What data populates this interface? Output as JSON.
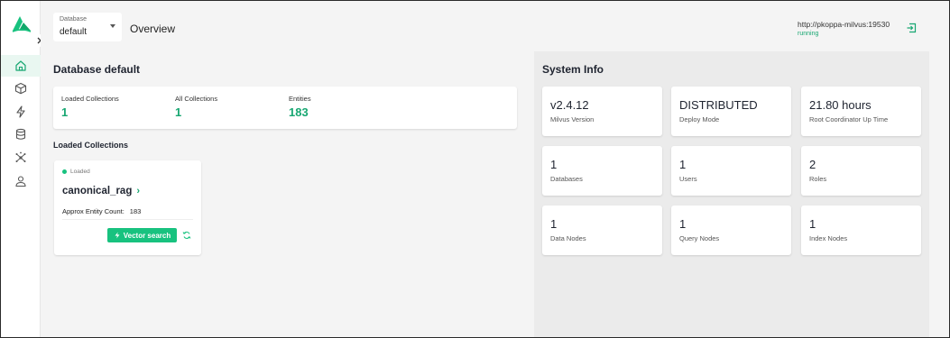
{
  "header": {
    "db_select_label": "Database",
    "db_select_value": "default",
    "page_title": "Overview",
    "connection_url": "http://pkoppa-milvus:19530",
    "connection_status": "running"
  },
  "overview": {
    "title": "Database default",
    "stats": [
      {
        "label": "Loaded Collections",
        "value": "1"
      },
      {
        "label": "All Collections",
        "value": "1"
      },
      {
        "label": "Entities",
        "value": "183"
      }
    ],
    "loaded_heading": "Loaded Collections",
    "collection": {
      "status": "Loaded",
      "name": "canonical_rag",
      "count_label": "Approx Entity Count:",
      "count_value": "183",
      "search_button": "Vector search"
    }
  },
  "system_info": {
    "title": "System Info",
    "cards": [
      {
        "value": "v2.4.12",
        "label": "Milvus Version"
      },
      {
        "value": "DISTRIBUTED",
        "label": "Deploy Mode"
      },
      {
        "value": "21.80 hours",
        "label": "Root Coordinator Up Time"
      },
      {
        "value": "1",
        "label": "Databases"
      },
      {
        "value": "1",
        "label": "Users"
      },
      {
        "value": "2",
        "label": "Roles"
      },
      {
        "value": "1",
        "label": "Data Nodes"
      },
      {
        "value": "1",
        "label": "Query Nodes"
      },
      {
        "value": "1",
        "label": "Index Nodes"
      }
    ]
  },
  "sidebar": {
    "items": [
      {
        "icon": "home-icon",
        "active": true
      },
      {
        "icon": "cube-icon",
        "active": false
      },
      {
        "icon": "bolt-icon",
        "active": false
      },
      {
        "icon": "database-icon",
        "active": false
      },
      {
        "icon": "nodes-icon",
        "active": false
      },
      {
        "icon": "user-icon",
        "active": false
      }
    ]
  },
  "colors": {
    "accent": "#18c27f",
    "accent_text": "#18a772"
  }
}
